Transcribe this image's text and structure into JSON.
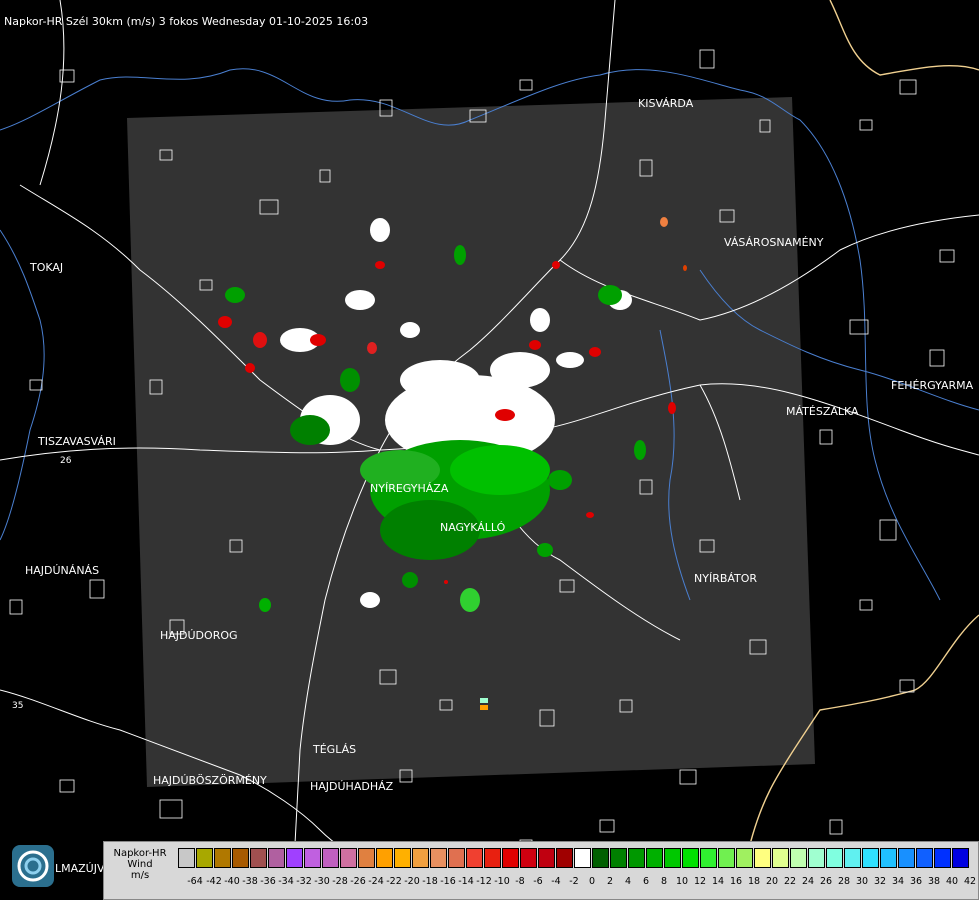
{
  "title": "Napkor-HR Szél 30km (m/s) 3 fokos Wednesday 01-10-2025 16:03",
  "places": [
    {
      "id": "kisvarda",
      "label": "KISVÁRDA"
    },
    {
      "id": "vasarosnameny",
      "label": "VÁSÁROSNAMÉNY"
    },
    {
      "id": "tokaj",
      "label": "TOKAJ"
    },
    {
      "id": "fehergyarmat",
      "label": "FEHÉRGYARMA"
    },
    {
      "id": "mateszalka",
      "label": "MÁTÉSZALKA"
    },
    {
      "id": "tiszavasvari",
      "label": "TISZAVASVÁRI"
    },
    {
      "id": "nyiregyhaza",
      "label": "NYÍREGYHÁZA"
    },
    {
      "id": "nagykallo",
      "label": "NAGYKÁLLÓ"
    },
    {
      "id": "hajdunanas",
      "label": "HAJDÚNÁNÁS"
    },
    {
      "id": "nyirbator",
      "label": "NYÍRBÁTOR"
    },
    {
      "id": "hajdudorog",
      "label": "HAJDÚDOROG"
    },
    {
      "id": "teglas",
      "label": "TÉGLÁS"
    },
    {
      "id": "hajduboszormeny",
      "label": "HAJDÚBÖSZÖRMÉNY"
    },
    {
      "id": "hajduhadhaz",
      "label": "HAJDÚHADHÁZ"
    }
  ],
  "road_numbers": [
    "35",
    "26"
  ],
  "legend": {
    "line1": "Napkor-HR",
    "line2": "Wind",
    "line3": "m/s",
    "ticks": [
      "-64",
      "-42",
      "-40",
      "-38",
      "-36",
      "-34",
      "-32",
      "-30",
      "-28",
      "-26",
      "-24",
      "-22",
      "-20",
      "-18",
      "-16",
      "-14",
      "-12",
      "-10",
      "-8",
      "-6",
      "-4",
      "-2",
      "0",
      "2",
      "4",
      "6",
      "8",
      "10",
      "12",
      "14",
      "16",
      "18",
      "20",
      "22",
      "24",
      "26",
      "28",
      "30",
      "32",
      "34",
      "36",
      "38",
      "40",
      "42"
    ],
    "colors": [
      "#c8c8c8",
      "#a8a800",
      "#b07800",
      "#a85a00",
      "#a05050",
      "#b060a0",
      "#a040ff",
      "#c060e0",
      "#c060c0",
      "#d070a0",
      "#e08040",
      "#ffa000",
      "#ffb000",
      "#f0a040",
      "#e89060",
      "#e07050",
      "#f04030",
      "#e82010",
      "#e00000",
      "#d00010",
      "#c00010",
      "#a00000",
      "#ffffff",
      "#006000",
      "#008000",
      "#009800",
      "#00b000",
      "#00c800",
      "#00e000",
      "#30f030",
      "#70f050",
      "#a0f060",
      "#ffff80",
      "#e0ff90",
      "#c0ffb0",
      "#a0ffd0",
      "#80ffe0",
      "#60f0f0",
      "#30e0ff",
      "#20c0ff",
      "#1890ff",
      "#1060ff",
      "#0030ff",
      "#0000e0"
    ]
  },
  "logo_text": "LMAZÚJVÁR"
}
